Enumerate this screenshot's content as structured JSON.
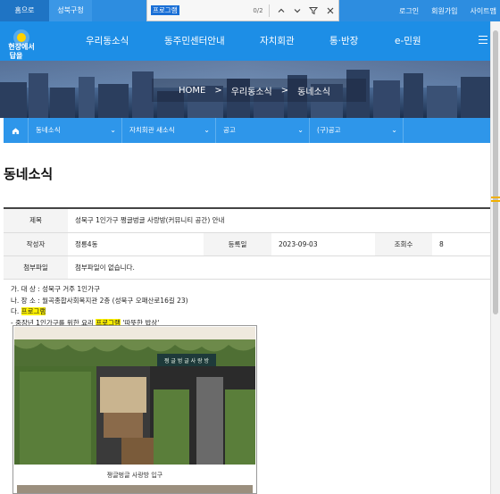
{
  "top_bar": {
    "home": "홈으로",
    "seongbuk": "성북구청",
    "login": "로그인",
    "signup": "회원가입",
    "sitemap": "사이트맵"
  },
  "find_bar": {
    "query": "프로그램",
    "count": "0/2"
  },
  "logo": {
    "text": "현장에서 답을"
  },
  "main_nav": {
    "items": [
      "우리동소식",
      "동주민센터안내",
      "자치회관",
      "통·반장",
      "e-민원"
    ]
  },
  "breadcrumb": {
    "home": "HOME",
    "level1": "우리동소식",
    "level2": "동네소식",
    "separator": ">"
  },
  "sub_nav": {
    "items": [
      "동네소식",
      "자치회관 새소식",
      "공고",
      "(구)공고"
    ]
  },
  "page_title": "동네소식",
  "post": {
    "title_label": "제목",
    "title": "성북구 1인가구 쩡글벙글 사랑방(커뮤니티 공간) 안내",
    "author_label": "작성자",
    "author": "정릉4동",
    "date_label": "등록일",
    "date": "2023-09-03",
    "views_label": "조회수",
    "views": "8",
    "attach_label": "첨부파일",
    "attach": "첨부파일이 없습니다."
  },
  "body": {
    "line1": "가. 대  상 : 성북구 거주 1인가구",
    "line2": "나. 장  소 : 월곡종합사회복지관 2층 (성북구 오패산로16길 23)",
    "line3_prefix": "다. ",
    "line3_hl": "프로그램",
    "line4_prefix": " - 중장년 1인가구를 위한 요리 ",
    "line4_hl": "프로그램",
    "line4_suffix": " '따뜻한 밥상'"
  },
  "photo": {
    "sign": "쩡 글 벙 글 사 랑 방",
    "caption": "쩡글벙글 사랑방 입구"
  },
  "colors": {
    "primary": "#1d8ee6",
    "top_bar": "#2d8de0",
    "highlight": "#fff200"
  }
}
